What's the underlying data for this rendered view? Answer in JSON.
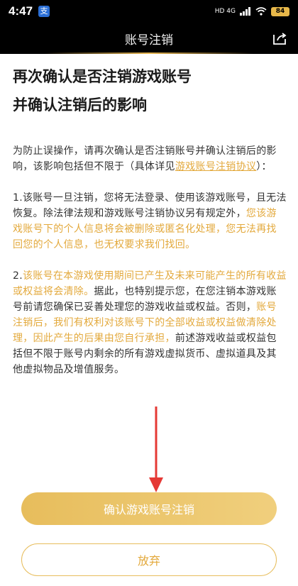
{
  "status_bar": {
    "time": "4:47",
    "app_badge": "支",
    "network": "HD 4G",
    "battery": "84"
  },
  "header": {
    "title": "账号注销"
  },
  "content": {
    "headline_line1": "再次确认是否注销游戏账号",
    "headline_line2": "并确认注销后的影响",
    "intro_text": "为防止误操作，请再次确认是否注销账号并确认注销后的影响，该影响包括但不限于（具体详见",
    "intro_link": "游戏账号注销协议",
    "intro_end": "）：",
    "p1_normal": "1.该账号一旦注销，您将无法登录、使用该游戏账号，且无法恢复。除法律法规和游戏账号注销协议另有规定外，",
    "p1_highlight": "您该游戏账号下的个人信息将会被删除或匿名化处理，您无法再找回您的个人信息，也无权要求我们找回。",
    "p2_prefix": "2.",
    "p2_highlight1": "该账号在本游戏使用期间已产生及未来可能产生的所有收益或权益将会清除。",
    "p2_normal1": "据此，也特别提示您，在您注销本游戏账号前请您确保已妥善处理您的游戏收益或权益。否则，",
    "p2_highlight2": "账号注销后，我们有权利对该账号下的全部收益或权益做清除处理，因此产生的后果由您自行承担，",
    "p2_normal2": "前述游戏收益或权益包括但不限于账号内剩余的所有游戏虚拟货币、虚拟道具及其他虚拟物品及增值服务。"
  },
  "buttons": {
    "confirm_label": "确认游戏账号注销",
    "cancel_label": "放弃"
  },
  "colors": {
    "accent": "#e3a93c",
    "arrow": "#e53935",
    "header_bg": "#000000"
  }
}
